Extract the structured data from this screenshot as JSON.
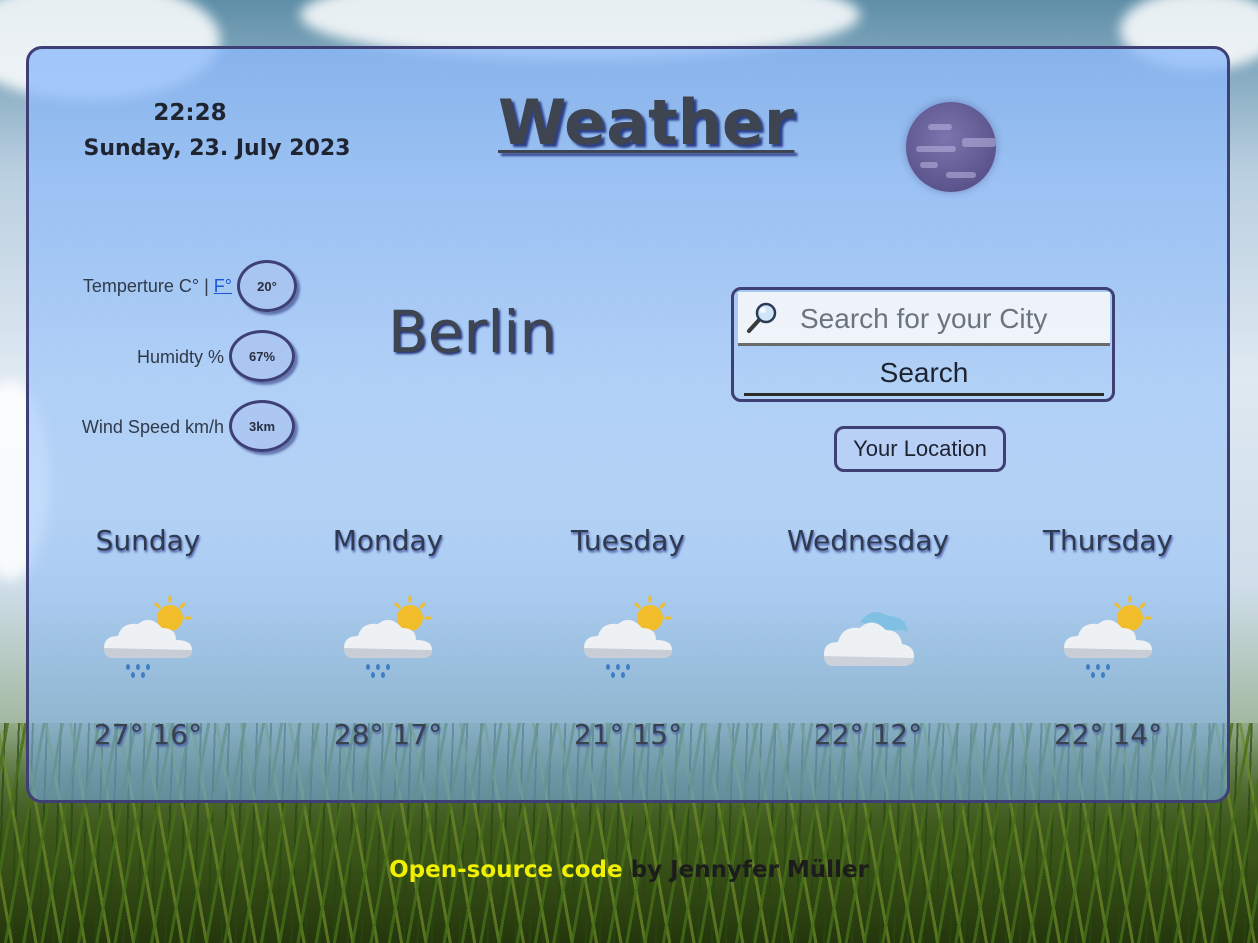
{
  "header": {
    "time": "22:28",
    "date": "Sunday, 23. July 2023",
    "title": "Weather",
    "moon_icon": "moon-icon"
  },
  "stats": {
    "temperature_label": "Temperture C° |",
    "fahrenheit_link": "F°",
    "temperature_value": "20°",
    "humidity_label": "Humidty %",
    "humidity_value": "67%",
    "wind_label": "Wind Speed km/h",
    "wind_value": "3km"
  },
  "city": "Berlin",
  "search": {
    "placeholder": "Search for your City",
    "button_label": "Search",
    "location_button_label": "Your Location"
  },
  "forecast": [
    {
      "day": "Sunday",
      "temps": "27° 16°",
      "icon": "sun-cloud-rain-icon"
    },
    {
      "day": "Monday",
      "temps": "28° 17°",
      "icon": "sun-cloud-rain-icon"
    },
    {
      "day": "Tuesday",
      "temps": "21° 15°",
      "icon": "sun-cloud-rain-icon"
    },
    {
      "day": "Wednesday",
      "temps": "22° 12°",
      "icon": "cloud-icon"
    },
    {
      "day": "Thursday",
      "temps": "22° 14°",
      "icon": "sun-cloud-rain-icon"
    }
  ],
  "footer": {
    "link_text": "Open-source code",
    "by_text": " by Jennyfer Müller"
  },
  "colors": {
    "card_border": "#3d3f75",
    "link_yellow": "#f0f000",
    "link_blue": "#1a55d8"
  }
}
